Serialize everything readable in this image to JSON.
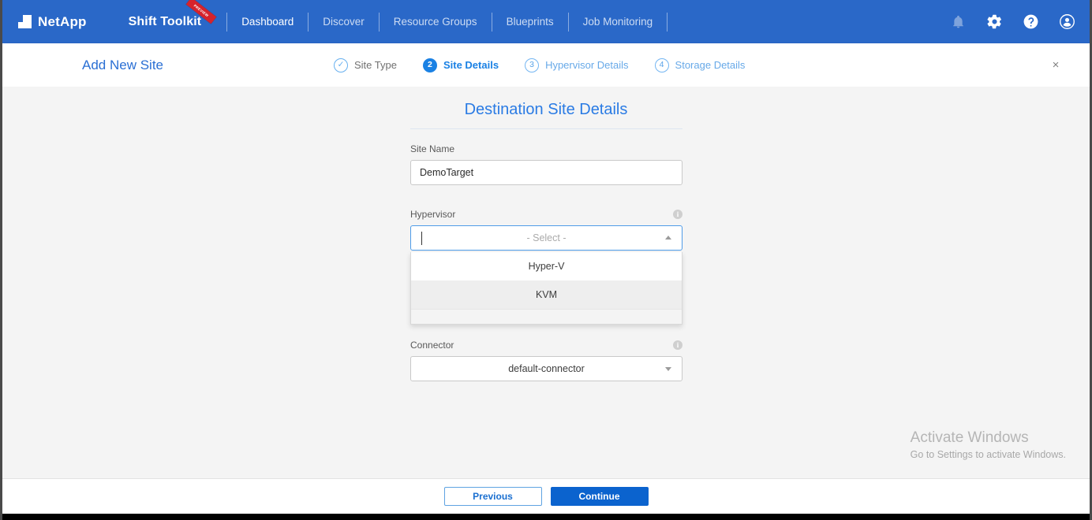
{
  "topnav": {
    "brand": "NetApp",
    "product": "Shift Toolkit",
    "ribbon_label": "PREVIEW",
    "links": [
      {
        "label": "Dashboard",
        "active": true
      },
      {
        "label": "Discover",
        "active": false
      },
      {
        "label": "Resource Groups",
        "active": false
      },
      {
        "label": "Blueprints",
        "active": false
      },
      {
        "label": "Job Monitoring",
        "active": false
      }
    ],
    "icons": [
      {
        "name": "bell-icon",
        "title": "Notifications"
      },
      {
        "name": "gear-icon",
        "title": "Settings"
      },
      {
        "name": "help-icon",
        "title": "Help"
      },
      {
        "name": "account-icon",
        "title": "Account"
      }
    ]
  },
  "wizard": {
    "title": "Add New Site",
    "close_label": "×",
    "steps": [
      {
        "marker": "✓",
        "label": "Site Type",
        "state": "done"
      },
      {
        "marker": "2",
        "label": "Site Details",
        "state": "current"
      },
      {
        "marker": "3",
        "label": "Hypervisor Details",
        "state": "todo"
      },
      {
        "marker": "4",
        "label": "Storage Details",
        "state": "todo"
      }
    ]
  },
  "form": {
    "title": "Destination Site Details",
    "site_name": {
      "label": "Site Name",
      "value": "DemoTarget",
      "placeholder": ""
    },
    "hypervisor": {
      "label": "Hypervisor",
      "value": "",
      "placeholder": "- Select -",
      "info_glyph": "i",
      "open": true,
      "options": [
        {
          "label": "Hyper-V",
          "hover": false
        },
        {
          "label": "KVM",
          "hover": true
        }
      ]
    },
    "connector": {
      "label": "Connector",
      "value": "default-connector",
      "info_glyph": "i"
    }
  },
  "footer": {
    "previous_label": "Previous",
    "continue_label": "Continue"
  },
  "watermark": {
    "line1": "Activate Windows",
    "line2": "Go to Settings to activate Windows."
  },
  "colors": {
    "nav_blue": "#2a68c8",
    "accent_blue": "#1a81e4",
    "primary_button": "#0b63ce",
    "ribbon_red": "#d6232b",
    "page_background": "#f4f4f4"
  }
}
